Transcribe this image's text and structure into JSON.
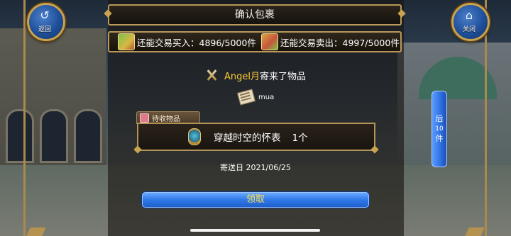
{
  "top_buttons": {
    "back": {
      "label": "返回",
      "glyph": "↺"
    },
    "close": {
      "label": "关闭",
      "glyph": "⌂"
    }
  },
  "dialog": {
    "title": "确认包裹",
    "buy_quota": "还能交易买入：4896/5000件",
    "sell_quota": "还能交易卖出：4997/5000件",
    "sender_name": "Angel月",
    "sender_suffix": "寄来了物品",
    "message": "mua",
    "pending_label": "待收物品",
    "item_name": "穿越时空的怀表",
    "item_qty": "1个",
    "send_date": "寄送日 2021/06/25",
    "claim_label": "领取"
  },
  "side_tab": {
    "top": "后",
    "num": "10",
    "bottom": "件"
  }
}
